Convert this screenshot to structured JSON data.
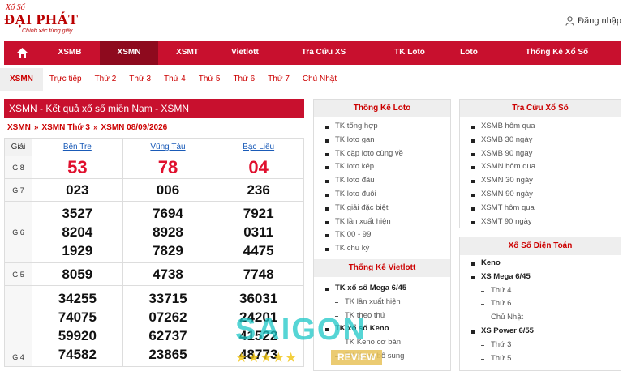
{
  "header": {
    "logo_top": "Xổ Số",
    "logo_main": "ĐẠI PHÁT",
    "logo_sub": "Chính xác từng giây",
    "login_label": "Đăng nhập"
  },
  "nav": {
    "items": [
      {
        "label": "XSMB"
      },
      {
        "label": "XSMN"
      },
      {
        "label": "XSMT"
      },
      {
        "label": "Vietlott"
      },
      {
        "label": "Tra Cứu XS"
      },
      {
        "label": "TK Loto"
      },
      {
        "label": "Loto"
      },
      {
        "label": "Thống Kê Xổ Số"
      }
    ],
    "active_index": 1
  },
  "subnav": {
    "items": [
      "XSMN",
      "Trực tiếp",
      "Thứ 2",
      "Thứ 3",
      "Thứ 4",
      "Thứ 5",
      "Thứ 6",
      "Thứ 7",
      "Chủ Nhật"
    ]
  },
  "results": {
    "title": "XSMN - Kết quả xổ số miền Nam - XSMN",
    "breadcrumb": [
      "XSMN",
      "XSMN Thứ 3",
      "XSMN 08/09/2026"
    ],
    "col_label": "Giải",
    "provinces": [
      "Bến Tre",
      "Vũng Tàu",
      "Bạc Liêu"
    ],
    "prizes": [
      {
        "label": "G.8",
        "values": [
          [
            "53"
          ],
          [
            "78"
          ],
          [
            "04"
          ]
        ]
      },
      {
        "label": "G.7",
        "values": [
          [
            "023"
          ],
          [
            "006"
          ],
          [
            "236"
          ]
        ]
      },
      {
        "label": "G.6",
        "values": [
          [
            "3527",
            "8204",
            "1929"
          ],
          [
            "7694",
            "8928",
            "7829"
          ],
          [
            "7921",
            "0311",
            "4475"
          ]
        ]
      },
      {
        "label": "G.5",
        "values": [
          [
            "8059"
          ],
          [
            "4738"
          ],
          [
            "7748"
          ]
        ]
      },
      {
        "label": "G.4",
        "values": [
          [
            "34255",
            "74075",
            "59920",
            "74582"
          ],
          [
            "33715",
            "07262",
            "62737",
            "23865"
          ],
          [
            "36031",
            "24201",
            "41522",
            "48773"
          ]
        ]
      }
    ]
  },
  "thong_ke_loto": {
    "title": "Thống Kê Loto",
    "items": [
      "TK tổng hợp",
      "TK loto gan",
      "TK cặp loto cùng về",
      "TK loto kép",
      "TK loto đầu",
      "TK loto đuôi",
      "TK giải đặc biệt",
      "TK lần xuất hiện",
      "TK 00 - 99",
      "TK chu kỳ"
    ]
  },
  "thong_ke_vietlott": {
    "title": "Thống Kê Vietlott",
    "groups": [
      {
        "label": "TK xổ số Mega 6/45",
        "items": [
          "TK lần xuất hiện",
          "TK theo thứ"
        ]
      },
      {
        "label": "TK xổ số Keno",
        "items": [
          "TK Keno cơ bản",
          "TK Keno bổ sung"
        ]
      }
    ]
  },
  "tra_cuu": {
    "title": "Tra Cứu Xổ Số",
    "items": [
      "XSMB hôm qua",
      "XSMB 30 ngày",
      "XSMB 90 ngày",
      "XSMN hôm qua",
      "XSMN 30 ngày",
      "XSMN 90 ngày",
      "XSMT hôm qua",
      "XSMT 90 ngày"
    ]
  },
  "dien_toan": {
    "title": "Xổ Số Điện Toán",
    "groups": [
      {
        "label": "Keno",
        "items": []
      },
      {
        "label": "XS Mega 6/45",
        "items": [
          "Thứ 4",
          "Thứ 6",
          "Chủ Nhật"
        ]
      },
      {
        "label": "XS Power 6/55",
        "items": [
          "Thứ 3",
          "Thứ 5"
        ]
      }
    ]
  },
  "watermark": {
    "text": "SAIGON",
    "stars": "★★★★★",
    "badge": "REVIEW"
  },
  "colors": {
    "brand_red": "#c8102e",
    "dark_red": "#8e0a1e",
    "link_blue": "#1a5bb8"
  }
}
